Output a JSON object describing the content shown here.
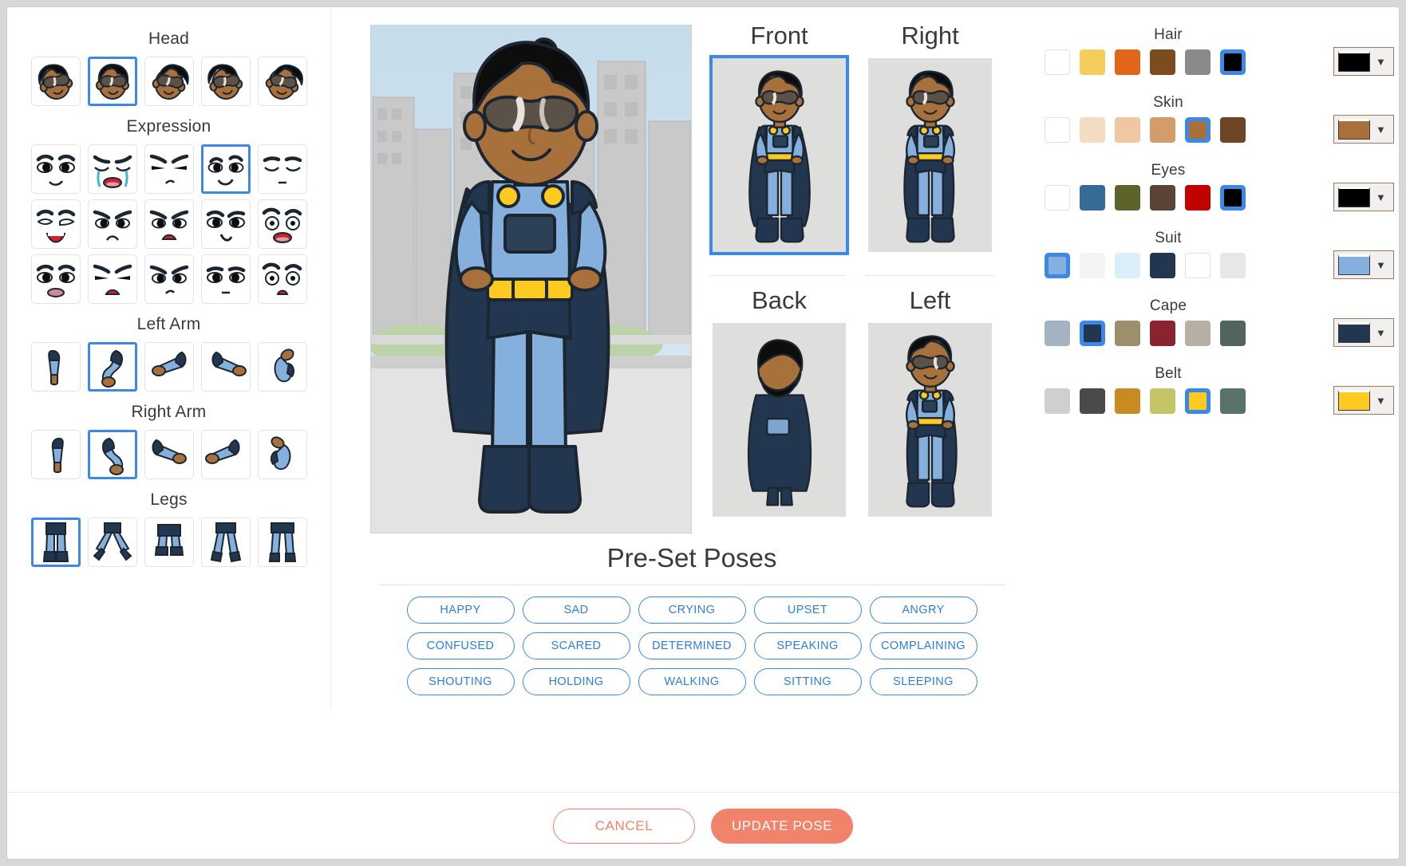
{
  "sections": {
    "head": "Head",
    "expression": "Expression",
    "left_arm": "Left Arm",
    "right_arm": "Right Arm",
    "legs": "Legs"
  },
  "head": {
    "selected_index": 1,
    "count": 5
  },
  "expression": {
    "selected_index": 3,
    "rows": 3,
    "cols": 5,
    "count": 15
  },
  "left_arm": {
    "selected_index": 1,
    "count": 5
  },
  "right_arm": {
    "selected_index": 1,
    "count": 5
  },
  "legs": {
    "selected_index": 0,
    "count": 5
  },
  "views": [
    {
      "label": "Front",
      "selected": true
    },
    {
      "label": "Right",
      "selected": false
    },
    {
      "label": "Back",
      "selected": false
    },
    {
      "label": "Left",
      "selected": false
    }
  ],
  "colors": [
    {
      "label": "Hair",
      "selected_index": 5,
      "swatches": [
        "#ffffff",
        "#f5cd5d",
        "#e2661a",
        "#7a4c1e",
        "#8a8a8a",
        "#000000"
      ],
      "picker_value": "#000000"
    },
    {
      "label": "Skin",
      "selected_index": 4,
      "swatches": [
        "#ffffff",
        "#f2ddc3",
        "#f0c6a3",
        "#d39d6b",
        "#a8703a",
        "#6f4528"
      ],
      "picker_value": "#a8703a"
    },
    {
      "label": "Eyes",
      "selected_index": 5,
      "swatches": [
        "#ffffff",
        "#376a94",
        "#5d6329",
        "#5b4338",
        "#c10000",
        "#000000"
      ],
      "picker_value": "#000000"
    },
    {
      "label": "Suit",
      "selected_index": 0,
      "swatches": [
        "#85b0dd",
        "#f4f4f4",
        "#ddeefb",
        "#22374f",
        "#ffffff",
        "#e8e8e8"
      ],
      "picker_value": "#85b0dd"
    },
    {
      "label": "Cape",
      "selected_index": 1,
      "swatches": [
        "#a4b3c2",
        "#22374f",
        "#9c8f6b",
        "#89242f",
        "#b7afa2",
        "#53645f"
      ],
      "picker_value": "#22374f"
    },
    {
      "label": "Belt",
      "selected_index": 4,
      "swatches": [
        "#cfcfcf",
        "#4a4a4a",
        "#c78b22",
        "#c5c468",
        "#fdca22",
        "#59736b"
      ],
      "picker_value": "#fdca22"
    }
  ],
  "presets": {
    "title": "Pre-Set Poses",
    "rows": [
      [
        "HAPPY",
        "SAD",
        "CRYING",
        "UPSET",
        "ANGRY"
      ],
      [
        "CONFUSED",
        "SCARED",
        "DETERMINED",
        "SPEAKING",
        "COMPLAINING"
      ],
      [
        "SHOUTING",
        "HOLDING",
        "WALKING",
        "SITTING",
        "SLEEPING"
      ]
    ]
  },
  "footer": {
    "cancel": "CANCEL",
    "update": "UPDATE POSE"
  },
  "theme": {
    "accent_blue": "#3b88e8",
    "accent_orange": "#f0836a",
    "skin": "#a8703a",
    "skin_shadow": "#8a5a2c",
    "suit": "#85b0dd",
    "suit_dark": "#22374f",
    "belt": "#fdca22",
    "outline": "#1c2630"
  }
}
